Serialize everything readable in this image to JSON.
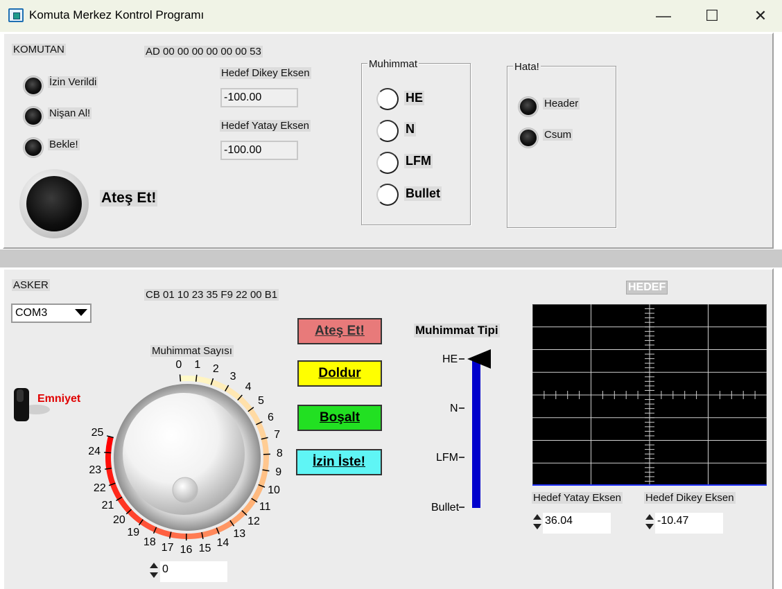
{
  "window": {
    "title": "Komuta Merkez Kontrol Programı",
    "minimize_glyph": "—",
    "maximize_glyph": "☐",
    "close_glyph": "✕"
  },
  "komutan": {
    "section_label": "KOMUTAN",
    "packet": "AD 00 00 00 00 00 00 53",
    "leds": [
      {
        "label": "İzin Verildi",
        "on": false
      },
      {
        "label": "Nişan Al!",
        "on": false
      },
      {
        "label": "Bekle!",
        "on": false
      }
    ],
    "fire_led_label": "Ateş Et!",
    "dikey_label": "Hedef Dikey Eksen",
    "dikey_value": "-100.00",
    "yatay_label": "Hedef Yatay Eksen",
    "yatay_value": "-100.00",
    "muhimmat": {
      "title": "Muhimmat",
      "options": [
        "HE",
        "N",
        "LFM",
        "Bullet"
      ]
    },
    "hata": {
      "title": "Hata!",
      "items": [
        "Header",
        "Csum"
      ]
    }
  },
  "asker": {
    "section_label": "ASKER",
    "port": "COM3",
    "packet": "CB 01 10 23 35 F9 22 00 B1",
    "toggle_label": "Emniyet",
    "knob": {
      "label": "Muhimmat Sayısı",
      "ticks": [
        "0",
        "1",
        "2",
        "3",
        "4",
        "5",
        "6",
        "7",
        "8",
        "9",
        "10",
        "11",
        "12",
        "13",
        "14",
        "15",
        "16",
        "17",
        "18",
        "19",
        "20",
        "21",
        "22",
        "23",
        "24",
        "25"
      ],
      "value": "0",
      "min": 0,
      "max": 25
    },
    "buttons": {
      "fire": "Ateş Et!",
      "fill": "Doldur",
      "empty": "Boşalt",
      "request": "İzin İste!"
    },
    "ammo_type": {
      "title": "Muhimmat Tipi",
      "levels": [
        "HE",
        "N",
        "LFM",
        "Bullet"
      ],
      "selected": "HE"
    },
    "target": {
      "title": "HEDEF",
      "yatay_label": "Hedef Yatay Eksen",
      "yatay_value": "36.04",
      "dikey_label": "Hedef Dikey Eksen",
      "dikey_value": "-10.47"
    },
    "colors": {
      "fire_btn": "#e87a7a",
      "fill_btn": "#ffff00",
      "empty_btn": "#22e022",
      "request_btn": "#5ff5f5",
      "slider_fill": "#0000cc",
      "toggle_text": "#e00000"
    }
  }
}
